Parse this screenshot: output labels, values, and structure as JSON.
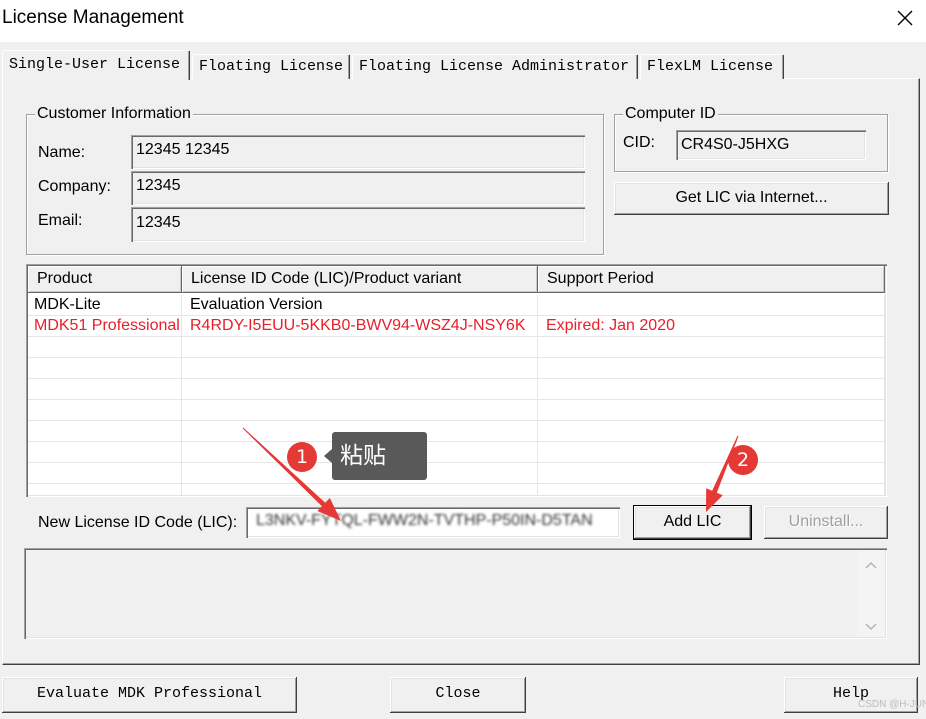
{
  "window": {
    "title": "License Management"
  },
  "icons": {
    "close": "close-icon",
    "scroll_up": "chevron-up-icon",
    "scroll_down": "chevron-down-icon"
  },
  "tabs": [
    {
      "label": "Single-User License",
      "selected": true
    },
    {
      "label": "Floating License",
      "selected": false
    },
    {
      "label": "Floating License Administrator",
      "selected": false
    },
    {
      "label": "FlexLM License",
      "selected": false
    }
  ],
  "customer_info": {
    "title": "Customer Information",
    "name_label": "Name:",
    "name_value": "12345 12345",
    "company_label": "Company:",
    "company_value": "12345",
    "email_label": "Email:",
    "email_value": "12345"
  },
  "computer_id": {
    "title": "Computer ID",
    "cid_label": "CID:",
    "cid_value": "CR4S0-J5HXG"
  },
  "get_lic_button": "Get LIC via Internet...",
  "license_table": {
    "columns": [
      "Product",
      "License ID Code (LIC)/Product variant",
      "Support Period"
    ],
    "rows": [
      {
        "product": "MDK-Lite",
        "lic": "Evaluation Version",
        "support": "",
        "status": "normal"
      },
      {
        "product": "MDK51 Professional",
        "lic": "R4RDY-I5EUU-5KKB0-BWV94-WSZ4J-NSY6K",
        "support": "Expired: Jan 2020",
        "status": "expired"
      }
    ]
  },
  "new_lic": {
    "label": "New License ID Code (LIC):",
    "value": "L3NKV-FYTQL-FWW2N-TVTHP-P50IN-D5TAN"
  },
  "add_lic_button": "Add LIC",
  "uninstall_button": "Uninstall...",
  "footer": {
    "evaluate": "Evaluate MDK Professional",
    "close": "Close",
    "help": "Help"
  },
  "annotations": {
    "step1_number": "1",
    "step1_callout": "粘贴",
    "step2_number": "2"
  },
  "watermark": "CSDN @H-JUN",
  "colors": {
    "dialog_bg": "#f0f0f0",
    "expired_text": "#e8202a",
    "annotation_red": "#e53935",
    "callout_bg": "#595959",
    "disabled_text": "#a0a0a0"
  }
}
